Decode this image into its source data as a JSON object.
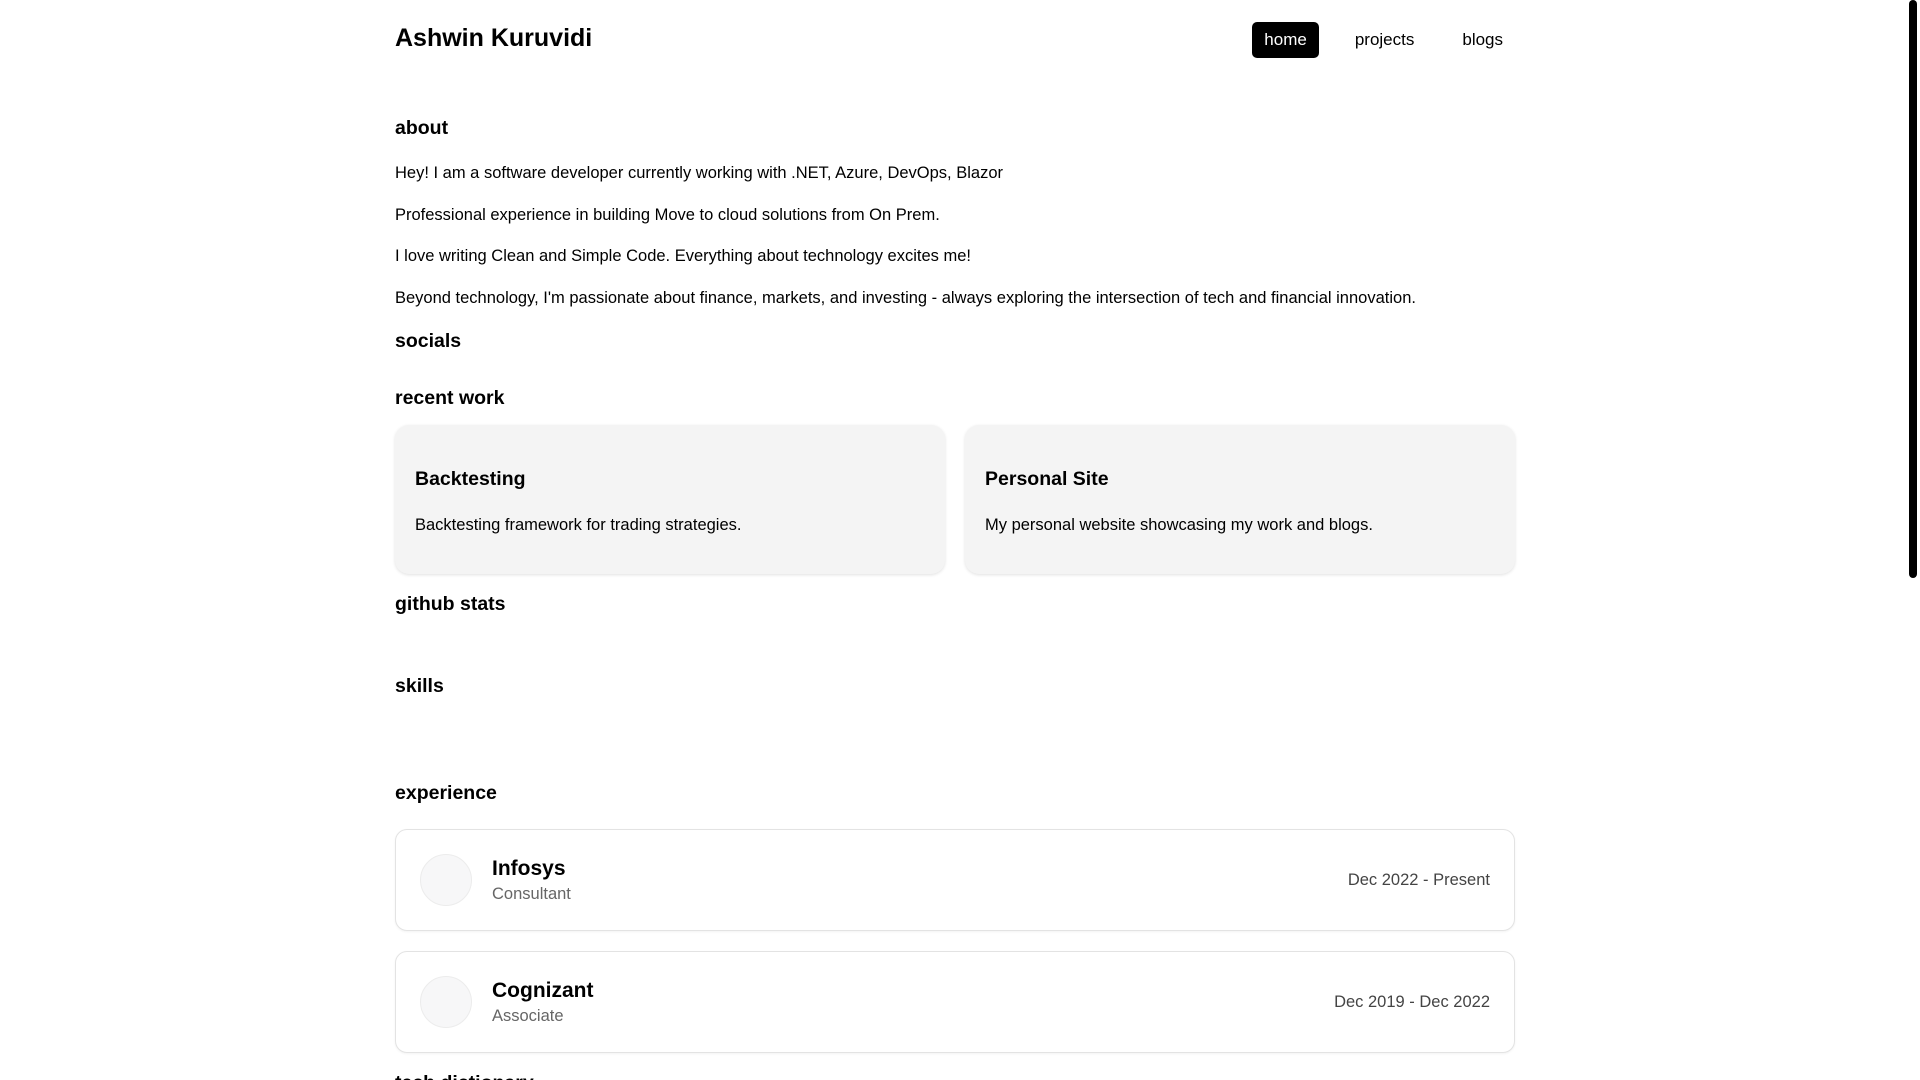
{
  "header": {
    "brand": "Ashwin Kuruvidi",
    "nav": [
      {
        "label": "home",
        "active": true
      },
      {
        "label": "projects",
        "active": false
      },
      {
        "label": "blogs",
        "active": false
      }
    ]
  },
  "about": {
    "heading": "about",
    "lines": [
      "Hey! I am a software developer currently working with .NET, Azure, DevOps, Blazor",
      "Professional experience in building Move to cloud solutions from On Prem.",
      "I love writing Clean and Simple Code. Everything about technology excites me!",
      "Beyond technology, I'm passionate about finance, markets, and investing - always exploring the intersection of tech and financial innovation."
    ]
  },
  "socials": {
    "heading": "socials"
  },
  "recent_work": {
    "heading": "recent work",
    "projects": [
      {
        "title": "Backtesting",
        "description": "Backtesting framework for trading strategies."
      },
      {
        "title": "Personal Site",
        "description": "My personal website showcasing my work and blogs."
      }
    ]
  },
  "github_stats": {
    "heading": "github stats"
  },
  "skills": {
    "heading": "skills"
  },
  "experience": {
    "heading": "experience",
    "items": [
      {
        "company": "Infosys",
        "role": "Consultant",
        "dates": "Dec 2022 - Present"
      },
      {
        "company": "Cognizant",
        "role": "Associate",
        "dates": "Dec 2019 - Dec 2022"
      }
    ]
  },
  "next_section": {
    "heading": "tech dictionary"
  }
}
